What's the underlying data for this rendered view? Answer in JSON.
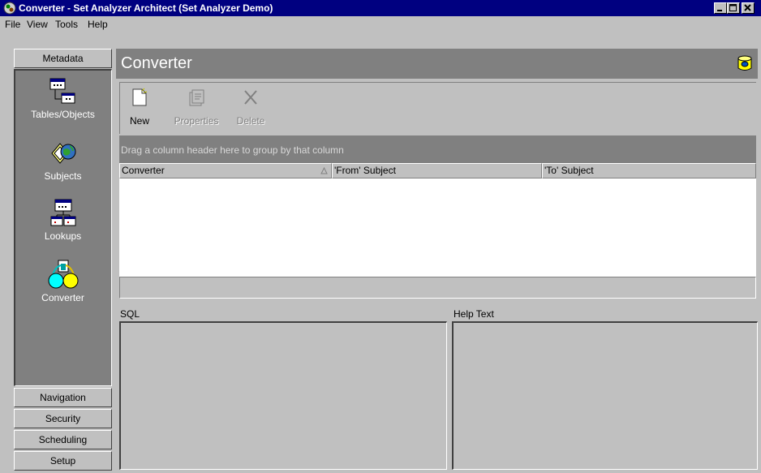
{
  "window": {
    "title": "Converter - Set Analyzer Architect (Set Analyzer Demo)"
  },
  "menu": [
    {
      "label": "File"
    },
    {
      "label": "View"
    },
    {
      "label": "Tools"
    },
    {
      "label": "Help"
    }
  ],
  "sidebar": {
    "metadata_label": "Metadata",
    "items": [
      {
        "label": "Tables/Objects",
        "icon": "tables-objects-icon"
      },
      {
        "label": "Subjects",
        "icon": "subjects-icon"
      },
      {
        "label": "Lookups",
        "icon": "lookups-icon"
      },
      {
        "label": "Converter",
        "icon": "converter-icon"
      }
    ],
    "bottom_buttons": [
      {
        "label": "Navigation"
      },
      {
        "label": "Security"
      },
      {
        "label": "Scheduling"
      },
      {
        "label": "Setup"
      }
    ]
  },
  "header": {
    "title": "Converter",
    "icon": "database-icon"
  },
  "toolbar": {
    "new_label": "New",
    "properties_label": "Properties",
    "delete_label": "Delete"
  },
  "grid": {
    "group_hint": "Drag a column header here to group by that column",
    "columns": [
      {
        "label": "Converter",
        "sort": "ascending"
      },
      {
        "label": "'From' Subject"
      },
      {
        "label": "'To' Subject"
      }
    ],
    "rows": []
  },
  "panes": {
    "sql_label": "SQL",
    "help_label": "Help Text"
  },
  "colors": {
    "titlebar": "#000080",
    "face": "#c0c0c0",
    "dark_panel": "#808080"
  }
}
